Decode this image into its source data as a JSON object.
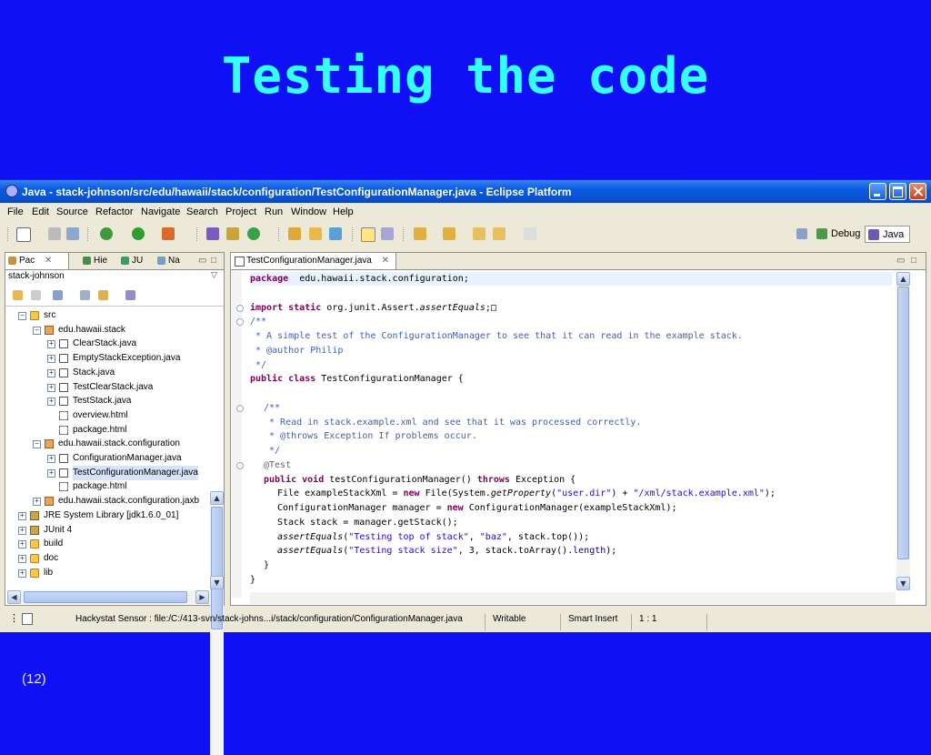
{
  "slide": {
    "title": "Testing the code",
    "page_number": "(12)"
  },
  "window": {
    "title": "Java - stack-johnson/src/edu/hawaii/stack/configuration/TestConfigurationManager.java - Eclipse Platform"
  },
  "menu": [
    "File",
    "Edit",
    "Source",
    "Refactor",
    "Navigate",
    "Search",
    "Project",
    "Run",
    "Window",
    "Help"
  ],
  "perspectives": [
    {
      "label": "",
      "icon": "open-perspective-icon"
    },
    {
      "label": "Debug",
      "icon": "debug-icon"
    },
    {
      "label": "Java",
      "icon": "java-perspective-icon",
      "active": true
    }
  ],
  "left_tabs": [
    {
      "label": "Pac",
      "icon": "package-explorer-icon",
      "active": true
    },
    {
      "label": "Hie",
      "icon": "hierarchy-icon"
    },
    {
      "label": "JU",
      "icon": "junit-icon"
    },
    {
      "label": "Na",
      "icon": "navigator-icon"
    }
  ],
  "working_set": "stack-johnson",
  "tree": [
    {
      "label": "src",
      "level": 1,
      "icon": "folder",
      "toggle": "−"
    },
    {
      "label": "edu.hawaii.stack",
      "level": 2,
      "icon": "pkg",
      "toggle": "−"
    },
    {
      "label": "ClearStack.java",
      "level": 3,
      "icon": "java",
      "toggle": "+"
    },
    {
      "label": "EmptyStackException.java",
      "level": 3,
      "icon": "java",
      "toggle": "+"
    },
    {
      "label": "Stack.java",
      "level": 3,
      "icon": "java",
      "toggle": "+"
    },
    {
      "label": "TestClearStack.java",
      "level": 3,
      "icon": "java",
      "toggle": "+"
    },
    {
      "label": "TestStack.java",
      "level": 3,
      "icon": "java",
      "toggle": "+"
    },
    {
      "label": "overview.html",
      "level": 3,
      "icon": "html",
      "toggle": ""
    },
    {
      "label": "package.html",
      "level": 3,
      "icon": "html",
      "toggle": ""
    },
    {
      "label": "edu.hawaii.stack.configuration",
      "level": 2,
      "icon": "pkg",
      "toggle": "−"
    },
    {
      "label": "ConfigurationManager.java",
      "level": 3,
      "icon": "java",
      "toggle": "+"
    },
    {
      "label": "TestConfigurationManager.java",
      "level": 3,
      "icon": "java",
      "toggle": "+",
      "selected": true
    },
    {
      "label": "package.html",
      "level": 3,
      "icon": "html",
      "toggle": ""
    },
    {
      "label": "edu.hawaii.stack.configuration.jaxb",
      "level": 2,
      "icon": "pkg",
      "toggle": "+"
    },
    {
      "label": "JRE System Library [jdk1.6.0_01]",
      "level": 1,
      "icon": "lib",
      "toggle": "+"
    },
    {
      "label": "JUnit 4",
      "level": 1,
      "icon": "lib",
      "toggle": "+"
    },
    {
      "label": "build",
      "level": 1,
      "icon": "folder",
      "toggle": "+"
    },
    {
      "label": "doc",
      "level": 1,
      "icon": "folder",
      "toggle": "+"
    },
    {
      "label": "lib",
      "level": 1,
      "icon": "folder",
      "toggle": "+"
    }
  ],
  "editor": {
    "tab": "TestConfigurationManager.java",
    "lines": [
      {
        "row": 0,
        "indent": 0,
        "hl": true,
        "tokens": [
          [
            "kw",
            "package"
          ],
          [
            "",
            "  edu.hawaii.stack.configuration;"
          ]
        ]
      },
      {
        "row": 2,
        "indent": 0,
        "fold": true,
        "tokens": [
          [
            "kw",
            "import static"
          ],
          [
            "",
            " org.junit.Assert."
          ],
          [
            "it",
            "assertEquals"
          ],
          [
            "",
            ";"
          ],
          [
            "",
            "□"
          ]
        ]
      },
      {
        "row": 3,
        "indent": 0,
        "fold": true,
        "tokens": [
          [
            "cm",
            "/**"
          ]
        ]
      },
      {
        "row": 4,
        "indent": 0,
        "tokens": [
          [
            "cm",
            " * A simple test of the ConfigurationManager to see that it can read in the example stack."
          ]
        ]
      },
      {
        "row": 5,
        "indent": 0,
        "tokens": [
          [
            "cm",
            " * @author Philip"
          ]
        ]
      },
      {
        "row": 6,
        "indent": 0,
        "tokens": [
          [
            "cm",
            " */"
          ]
        ]
      },
      {
        "row": 7,
        "indent": 0,
        "tokens": [
          [
            "kw",
            "public class"
          ],
          [
            "",
            " TestConfigurationManager {"
          ]
        ]
      },
      {
        "row": 9,
        "indent": 1,
        "fold": true,
        "tokens": [
          [
            "cm",
            "/**"
          ]
        ]
      },
      {
        "row": 10,
        "indent": 1,
        "tokens": [
          [
            "cm",
            " * Read in stack.example.xml and see that it was processed correctly."
          ]
        ]
      },
      {
        "row": 11,
        "indent": 1,
        "tokens": [
          [
            "cm",
            " * @throws Exception If problems occur."
          ]
        ]
      },
      {
        "row": 12,
        "indent": 1,
        "tokens": [
          [
            "cm",
            " */"
          ]
        ]
      },
      {
        "row": 13,
        "indent": 1,
        "fold": true,
        "tokens": [
          [
            "an",
            "@Test"
          ]
        ]
      },
      {
        "row": 14,
        "indent": 1,
        "tokens": [
          [
            "kw",
            "public void"
          ],
          [
            "",
            " testConfigurationManager() "
          ],
          [
            "kw",
            "throws"
          ],
          [
            "",
            " Exception {"
          ]
        ]
      },
      {
        "row": 15,
        "indent": 2,
        "tokens": [
          [
            "",
            "File exampleStackXml = "
          ],
          [
            "kw",
            "new"
          ],
          [
            "",
            " File(System."
          ],
          [
            "it",
            "getProperty"
          ],
          [
            "",
            "("
          ],
          [
            "st",
            "\"user.dir\""
          ],
          [
            "",
            ") + "
          ],
          [
            "st",
            "\"/xml/stack.example.xml\""
          ],
          [
            "",
            ");"
          ]
        ]
      },
      {
        "row": 16,
        "indent": 2,
        "tokens": [
          [
            "",
            "ConfigurationManager manager = "
          ],
          [
            "kw",
            "new"
          ],
          [
            "",
            " ConfigurationManager(exampleStackXml);"
          ]
        ]
      },
      {
        "row": 17,
        "indent": 2,
        "tokens": [
          [
            "",
            "Stack stack = manager.getStack();"
          ]
        ]
      },
      {
        "row": 18,
        "indent": 2,
        "tokens": [
          [
            "it",
            "assertEquals"
          ],
          [
            "",
            "("
          ],
          [
            "st",
            "\"Testing top of stack\""
          ],
          [
            "",
            ", "
          ],
          [
            "st",
            "\"baz\""
          ],
          [
            "",
            ", stack.top());"
          ]
        ]
      },
      {
        "row": 19,
        "indent": 2,
        "tokens": [
          [
            "it",
            "assertEquals"
          ],
          [
            "",
            "("
          ],
          [
            "st",
            "\"Testing stack size\""
          ],
          [
            "",
            ", 3, stack.toArray()."
          ],
          [
            "fd",
            "length"
          ],
          [
            "",
            ");"
          ]
        ]
      },
      {
        "row": 20,
        "indent": 1,
        "tokens": [
          [
            "",
            "}"
          ]
        ]
      },
      {
        "row": 21,
        "indent": 0,
        "tokens": [
          [
            "",
            "}"
          ]
        ]
      }
    ]
  },
  "status": {
    "sensor": "Hackystat Sensor : file:/C:/413-svn/stack-johns...i/stack/configuration/ConfigurationManager.java",
    "mode": "Writable",
    "insert": "Smart Insert",
    "position": "1 : 1"
  },
  "colors": {
    "slide_bg": "#1010f4",
    "title": "#33ffff",
    "keyword": "#7f0055",
    "comment": "#3f5fbf",
    "string": "#2a00ff"
  }
}
